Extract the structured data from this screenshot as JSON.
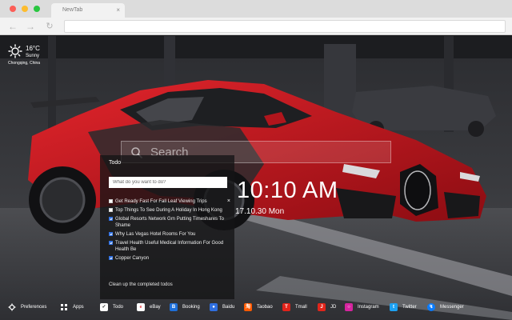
{
  "browser": {
    "tab_title": "NewTab",
    "tab_close": "×",
    "omnibox_value": ""
  },
  "weather": {
    "temperature": "16°C",
    "condition": "Sunny",
    "location": "Chongqing, China",
    "icon": "sun-icon"
  },
  "search": {
    "placeholder": "Search"
  },
  "clock": {
    "time": "10:10 AM",
    "date": "17.10.30 Mon"
  },
  "todo": {
    "title": "Todo",
    "input_placeholder": "What do you want to do?",
    "items": [
      {
        "text": "Get Ready Fast For Fall Leaf Viewing Trips",
        "done": false,
        "delete": "×"
      },
      {
        "text": "Top Things To See During A Holiday In Hong Kong",
        "done": false
      },
      {
        "text": "Global Resorts Network Grn Putting Timeshares To Shame",
        "done": true
      },
      {
        "text": "Why Las Vegas Hotel Rooms For You",
        "done": true
      },
      {
        "text": "Travel Health Useful Medical Information For Good Health Be",
        "done": true
      },
      {
        "text": "Copper Canyon",
        "done": true
      }
    ],
    "cleanup_label": "Clean up the completed todos"
  },
  "bottom_bar": {
    "items": [
      {
        "label": "Preferences",
        "icon": "gear-icon",
        "color": "#000000"
      },
      {
        "label": "Apps",
        "icon": "apps-grid-icon",
        "color": "#000000"
      },
      {
        "label": "Todo",
        "icon": "todo-check-icon",
        "color": "#ffffff"
      },
      {
        "label": "eBay",
        "icon": "ebay-icon",
        "color": "#ffffff"
      },
      {
        "label": "Booking",
        "icon": "booking-icon",
        "color": "#1e6fd9"
      },
      {
        "label": "Baidu",
        "icon": "baidu-icon",
        "color": "#2f6fe0"
      },
      {
        "label": "Taobao",
        "icon": "taobao-icon",
        "color": "#ff5a00"
      },
      {
        "label": "Tmall",
        "icon": "tmall-icon",
        "color": "#e2231a"
      },
      {
        "label": "JD",
        "icon": "jd-icon",
        "color": "#e1251b"
      },
      {
        "label": "Instagram",
        "icon": "instagram-icon",
        "color": "#d6249f"
      },
      {
        "label": "Twitter",
        "icon": "twitter-icon",
        "color": "#1da1f2"
      },
      {
        "label": "Messenger",
        "icon": "messenger-icon",
        "color": "#0a7cff"
      }
    ]
  },
  "colors": {
    "car_red": "#c8141c",
    "checkbox_blue": "#2f6fe0"
  }
}
